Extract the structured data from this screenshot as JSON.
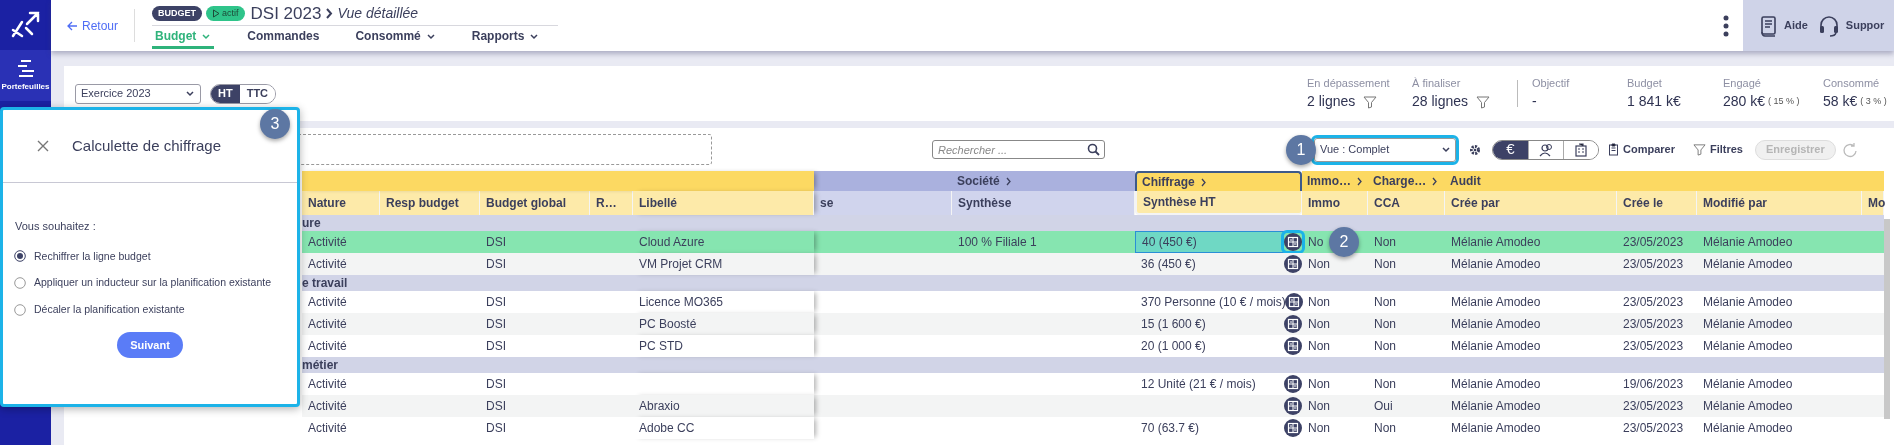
{
  "sidebar": {
    "items": [
      {
        "label": "Portefeuilles",
        "selected": true
      }
    ]
  },
  "header": {
    "back": "Retour",
    "badges": [
      {
        "kind": "type",
        "label": "BUDGET"
      },
      {
        "kind": "status",
        "label": "actif"
      }
    ],
    "title": "DSI 2023",
    "subtitle": "Vue détaillée",
    "tabs": [
      {
        "label": "Budget",
        "selected": true,
        "has_menu": true
      },
      {
        "label": "Commandes",
        "selected": false,
        "has_menu": false
      },
      {
        "label": "Consommé",
        "selected": false,
        "has_menu": true
      },
      {
        "label": "Rapports",
        "selected": false,
        "has_menu": true
      }
    ],
    "help": [
      {
        "kind": "book",
        "label": "Aide"
      },
      {
        "kind": "headset",
        "label": "Suppor"
      }
    ]
  },
  "filters": {
    "period": "Exercice 2023",
    "tax_modes": [
      {
        "label": "HT",
        "selected": true
      },
      {
        "label": "TTC",
        "selected": false
      }
    ]
  },
  "alerts": [
    {
      "label": "En dépassement",
      "value": "2 lignes"
    },
    {
      "label": "À finaliser",
      "value": "28 lignes"
    }
  ],
  "totals": [
    {
      "label": "Objectif",
      "value": "-"
    },
    {
      "label": "Budget",
      "value": "1 841 k€"
    },
    {
      "label": "Engagé",
      "value": "280 k€",
      "share": "( 15 % )"
    },
    {
      "label": "Consommé",
      "value": "58 k€",
      "share": "( 3 % )"
    }
  ],
  "toolbar": {
    "search_placeholder": "Rechercher ...",
    "callout": "1",
    "view": "Vue : Complet",
    "view_highlighted": true,
    "display_modes": [
      {
        "kind": "symbol",
        "label": "€",
        "selected": true
      },
      {
        "kind": "people",
        "selected": false
      },
      {
        "kind": "building",
        "selected": false
      }
    ],
    "compare": "Comparer",
    "filters": "Filtres",
    "save": {
      "label": "Enregistrer",
      "disabled": true
    }
  },
  "table": {
    "callout": "2",
    "column_groups": [
      {
        "color": "#fcd962",
        "columns": [
          {
            "label": "Nature"
          },
          {
            "label": "Resp budget"
          },
          {
            "label": "Budget global"
          },
          {
            "label": "R…"
          },
          {
            "label": "Libellé"
          }
        ]
      },
      {
        "color": "#aab1de",
        "columns": [
          {
            "label": "se"
          }
        ]
      },
      {
        "color": "#aab1de",
        "label": "Société",
        "expandable": true,
        "columns": [
          {
            "label": "Synthèse"
          }
        ]
      },
      {
        "color": "#fcd962",
        "label": "Chiffrage",
        "expandable": true,
        "highlighted": true,
        "columns": [
          {
            "label": "Synthèse HT"
          }
        ]
      },
      {
        "color": "#fcd962",
        "label": "Immo…",
        "expandable": true,
        "columns": [
          {
            "label": "Immo"
          }
        ]
      },
      {
        "color": "#fcd962",
        "label": "Charge…",
        "expandable": true,
        "columns": [
          {
            "label": "CCA"
          }
        ]
      },
      {
        "color": "#fcd962",
        "label": "Audit",
        "expandable": false,
        "columns": [
          {
            "label": "Crée par"
          },
          {
            "label": "Crée le"
          },
          {
            "label": "Modifié par"
          },
          {
            "label": "Mo"
          }
        ]
      }
    ],
    "rows": [
      {
        "kind": "group",
        "label": "ure"
      },
      {
        "kind": "line",
        "selected": true,
        "focused": true,
        "cells": [
          "Activité",
          null,
          "DSI",
          null,
          "Cloud Azure",
          null,
          "100 % Filiale 1",
          "40 (450 €)",
          "No",
          "Non",
          "Mélanie Amodeo",
          "23/05/2023",
          "Mélanie Amodeo"
        ]
      },
      {
        "kind": "line",
        "selected": false,
        "focused": false,
        "cells": [
          "Activité",
          null,
          "DSI",
          null,
          "VM Projet CRM",
          null,
          null,
          "36 (450 €)",
          "Non",
          "Non",
          "Mélanie Amodeo",
          "23/05/2023",
          "Mélanie Amodeo"
        ]
      },
      {
        "kind": "group",
        "label": "e travail"
      },
      {
        "kind": "line",
        "selected": false,
        "focused": false,
        "cells": [
          "Activité",
          null,
          "DSI",
          null,
          "Licence MO365",
          null,
          null,
          "370 Personne (10 € / mois)",
          "Non",
          "Non",
          "Mélanie Amodeo",
          "23/05/2023",
          "Mélanie Amodeo"
        ]
      },
      {
        "kind": "line",
        "selected": false,
        "focused": false,
        "cells": [
          "Activité",
          null,
          "DSI",
          null,
          "PC Boosté",
          null,
          null,
          "15 (1 600 €)",
          "Non",
          "Non",
          "Mélanie Amodeo",
          "23/05/2023",
          "Mélanie Amodeo"
        ]
      },
      {
        "kind": "line",
        "selected": false,
        "focused": false,
        "cells": [
          "Activité",
          null,
          "DSI",
          null,
          "PC STD",
          null,
          null,
          "20 (1 000 €)",
          "Non",
          "Non",
          "Mélanie Amodeo",
          "23/05/2023",
          "Mélanie Amodeo"
        ]
      },
      {
        "kind": "group",
        "label": "métier"
      },
      {
        "kind": "line",
        "selected": false,
        "focused": false,
        "cells": [
          "Activité",
          null,
          "DSI",
          null,
          null,
          null,
          null,
          "12 Unité (21 € / mois)",
          "Non",
          "Non",
          "Mélanie Amodeo",
          "19/06/2023",
          "Mélanie Amodeo"
        ]
      },
      {
        "kind": "line",
        "selected": false,
        "focused": false,
        "cells": [
          "Activité",
          null,
          "DSI",
          null,
          "Abraxio",
          null,
          null,
          null,
          "Non",
          "Oui",
          "Mélanie Amodeo",
          "23/05/2023",
          "Mélanie Amodeo"
        ]
      },
      {
        "kind": "line",
        "selected": false,
        "focused": false,
        "cells": [
          "Activité",
          null,
          "DSI",
          null,
          "Adobe CC",
          null,
          null,
          "70 (63.7 €)",
          "Non",
          "Non",
          "Mélanie Amodeo",
          "23/05/2023",
          "Mélanie Amodeo"
        ]
      }
    ]
  },
  "panel": {
    "title": "Calculette de chiffrage",
    "callout": "3",
    "prompt": "Vous souhaitez :",
    "options": [
      {
        "label": "Rechiffrer la ligne budget",
        "selected": true
      },
      {
        "label": "Appliquer un inducteur sur la planification existante",
        "selected": false
      },
      {
        "label": "Décaler la planification existante",
        "selected": false
      }
    ],
    "next": "Suivant"
  }
}
